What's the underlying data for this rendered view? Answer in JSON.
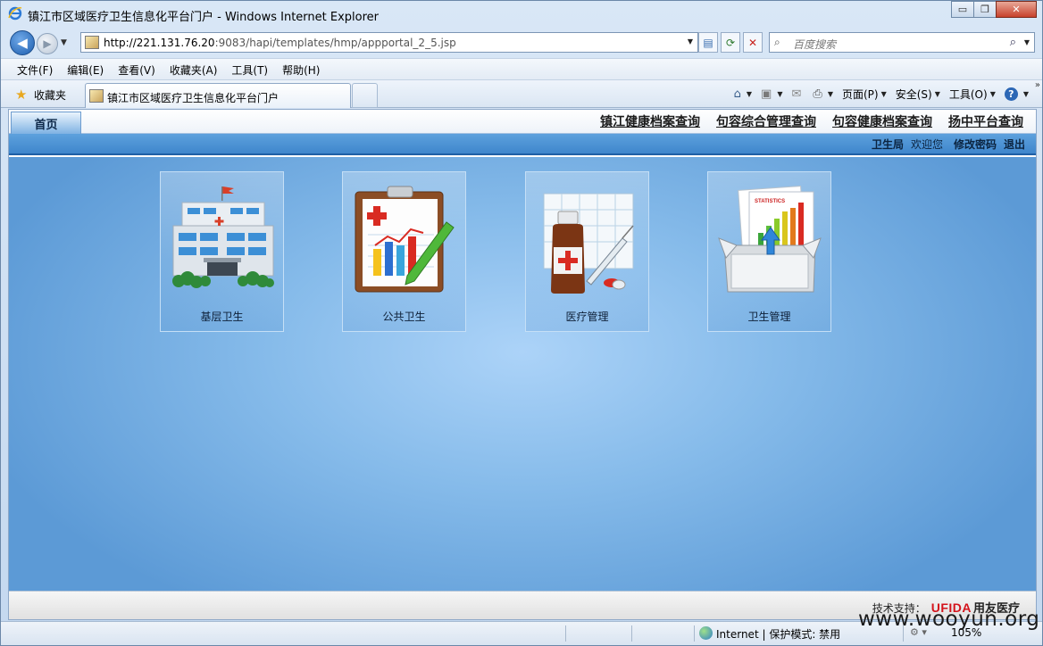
{
  "window": {
    "title": "镇江市区域医疗卫生信息化平台门户 - Windows Internet Explorer",
    "controls": {
      "minimize": "▭",
      "restore": "❐",
      "close": "✕"
    }
  },
  "address": {
    "url_host": "http://221.131.76.20",
    "url_rest": ":9083/hapi/templates/hmp/appportal_2_5.jsp"
  },
  "search": {
    "placeholder": "百度搜索"
  },
  "menu": [
    "文件(F)",
    "编辑(E)",
    "查看(V)",
    "收藏夹(A)",
    "工具(T)",
    "帮助(H)"
  ],
  "favorites": {
    "label": "收藏夹"
  },
  "tab": {
    "title": "镇江市区域医疗卫生信息化平台门户"
  },
  "commands": {
    "page": "页面(P)",
    "safety": "安全(S)",
    "tools": "工具(O)"
  },
  "portal": {
    "home_tab": "首页",
    "top_links": [
      "镇江健康档案查询",
      "句容综合管理查询",
      "句容健康档案查询",
      "扬中平台查询"
    ],
    "user": {
      "dept": "卫生局",
      "welcome": "欢迎您",
      "change_password": "修改密码",
      "logout": "退出"
    },
    "tiles": [
      {
        "label": "基层卫生"
      },
      {
        "label": "公共卫生"
      },
      {
        "label": "医疗管理"
      },
      {
        "label": "卫生管理"
      }
    ],
    "footer": {
      "support_label": "技术支持：",
      "brand_latin": "UFIDA",
      "brand_cn": "用友医疗"
    }
  },
  "status": {
    "zone": "Internet | 保护模式: 禁用",
    "zoom": "105%"
  },
  "watermark": "www.wooyun.org",
  "colors": {
    "accent": "#3f86cc",
    "brand_red": "#d4131b"
  }
}
